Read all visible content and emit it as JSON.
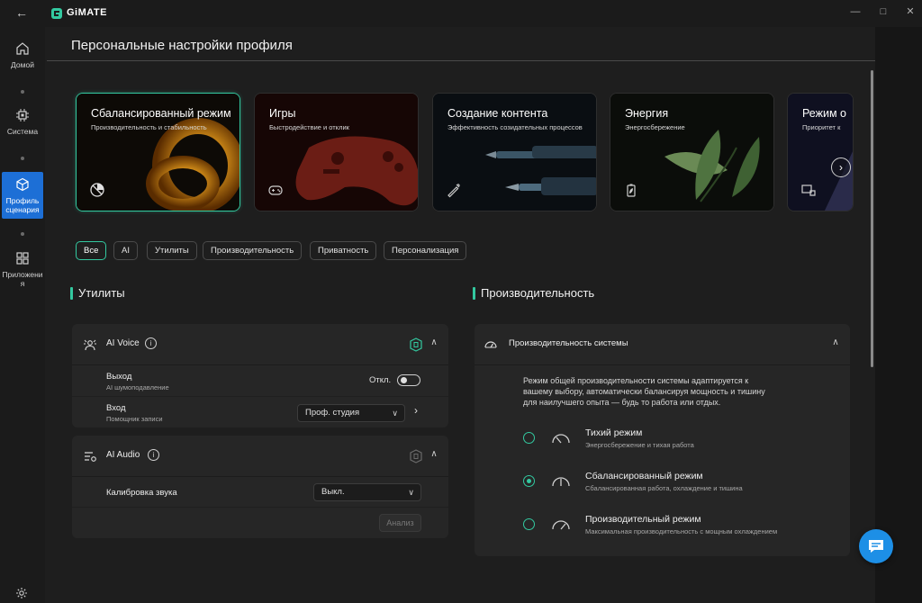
{
  "titlebar": {
    "app_name": "GiMATE",
    "back_glyph": "←",
    "minimize_glyph": "—",
    "maximize_glyph": "□",
    "close_glyph": "✕"
  },
  "nav": {
    "items": [
      {
        "label": "Домой",
        "icon": "home-icon"
      },
      {
        "label": "Система",
        "icon": "chip-icon"
      },
      {
        "label": "Профиль сценария",
        "icon": "cube-icon"
      },
      {
        "label": "Приложения",
        "icon": "apps-icon"
      }
    ],
    "active_index": 2,
    "settings_icon": "gear-icon"
  },
  "page": {
    "title": "Персональные настройки профиля"
  },
  "scenarios": [
    {
      "title": "Сбалансированный режим",
      "subtitle": "Производительность и стабильность",
      "icon": "balance-icon",
      "active": true
    },
    {
      "title": "Игры",
      "subtitle": "Быстродействие и отклик",
      "icon": "gamepad-icon",
      "active": false
    },
    {
      "title": "Создание контента",
      "subtitle": "Эффективность созидательных процессов",
      "icon": "pen-icon",
      "active": false
    },
    {
      "title": "Энергия",
      "subtitle": "Энергосбережение",
      "icon": "battery-leaf-icon",
      "active": false
    },
    {
      "title": "Режим о",
      "subtitle": "Приоритет к",
      "icon": "privacy-icon",
      "active": false
    }
  ],
  "carousel_next_glyph": "›",
  "filters": [
    {
      "label": "Все",
      "active": true
    },
    {
      "label": "AI",
      "active": false
    },
    {
      "label": "Утилиты",
      "active": false
    },
    {
      "label": "Производительность",
      "active": false
    },
    {
      "label": "Приватность",
      "active": false
    },
    {
      "label": "Персонализация",
      "active": false
    }
  ],
  "utilities": {
    "heading": "Утилиты",
    "ai_voice": {
      "title": "AI Voice",
      "info_glyph": "i",
      "output": {
        "title": "Выход",
        "subtitle": "AI шумоподавление",
        "toggle_label": "Откл.",
        "enabled": false
      },
      "input": {
        "title": "Вход",
        "subtitle": "Помощник записи",
        "select_value": "Проф. студия",
        "arrow_glyph": "›"
      }
    },
    "ai_audio": {
      "title": "AI Audio",
      "info_glyph": "i",
      "calibration": {
        "title": "Калибровка звука",
        "select_value": "Выкл."
      },
      "analyze_label": "Анализ"
    }
  },
  "performance": {
    "heading": "Производительность",
    "panel_title": "Производительность системы",
    "description": "Режим общей производительности системы адаптируется к вашему выбору, автоматически балансируя мощность и тишину для наилучшего опыта — будь то работа или отдых.",
    "description_lines": [
      "Режим общей производительности системы адаптируется к",
      "вашему выбору, автоматически балансируя мощность и тишину",
      "для наилучшего опыта — будь то работа или отдых."
    ],
    "modes": [
      {
        "title": "Тихий режим",
        "subtitle": "Энергосбережение и тихая работа",
        "selected": false
      },
      {
        "title": "Сбалансированный режим",
        "subtitle": "Сбалансированная работа, охлаждение и тишина",
        "selected": true
      },
      {
        "title": "Производительный режим",
        "subtitle": "Максимальная производительность с мощным охлаждением",
        "selected": false
      }
    ]
  },
  "colors": {
    "accent": "#33c9a0",
    "nav_active": "#1d6fd6",
    "chat_button": "#1d8fe6"
  }
}
